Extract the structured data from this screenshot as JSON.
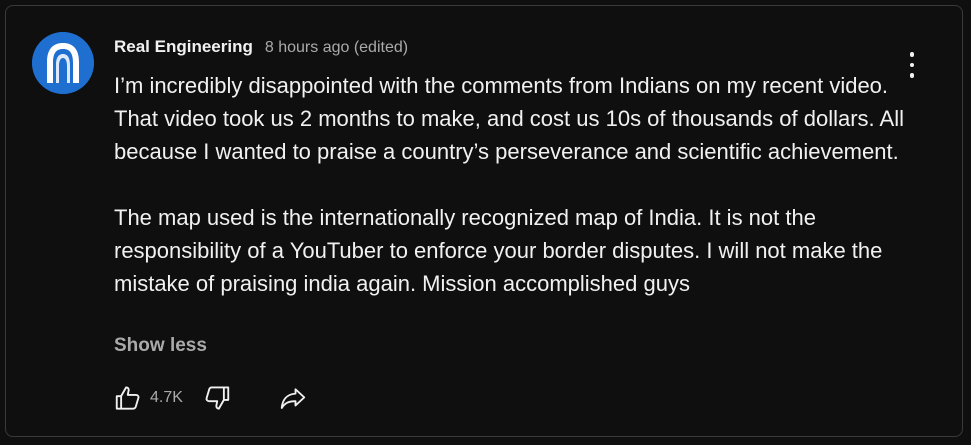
{
  "comment": {
    "author": "Real Engineering",
    "timestamp": "8 hours ago (edited)",
    "paragraphs": [
      "I’m incredibly disappointed with the comments from Indians on my recent video. That video took us 2 months to make, and cost us 10s of thousands of dollars. All because I wanted to praise a country’s perseverance and scientific achievement.",
      "The map used is the internationally recognized map of India. It is not the responsibility of a YouTuber to enforce your border disputes. I will not make the mistake of praising india again. Mission accomplished guys"
    ],
    "show_less_label": "Show less",
    "like_count": "4.7K"
  },
  "icons": {
    "avatar": "real-engineering-logo",
    "menu": "more-vertical-icon",
    "like": "thumbs-up-icon",
    "dislike": "thumbs-down-icon",
    "share": "share-arrow-icon"
  },
  "colors": {
    "background": "#0f0f0f",
    "border": "#3a3a3a",
    "text_primary": "#f1f1f1",
    "text_secondary": "#aaaaaa",
    "avatar_bg": "#1f6fd0"
  }
}
